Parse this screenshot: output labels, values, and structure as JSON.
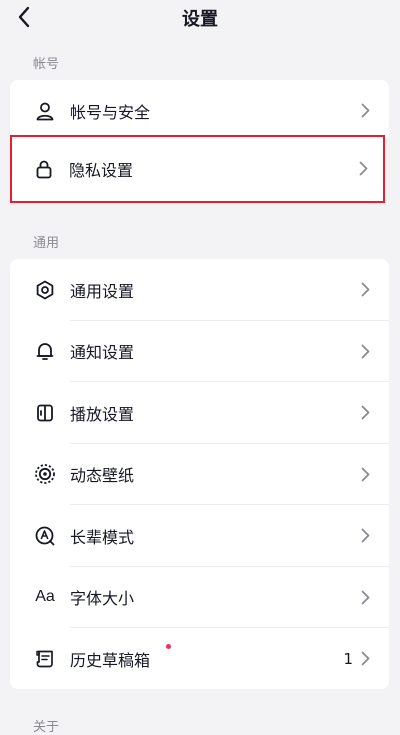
{
  "header": {
    "title": "设置"
  },
  "sections": {
    "account": {
      "label": "帐号",
      "items": [
        {
          "label": "帐号与安全",
          "icon": "user-icon"
        },
        {
          "label": "隐私设置",
          "icon": "lock-icon"
        }
      ]
    },
    "general": {
      "label": "通用",
      "items": [
        {
          "label": "通用设置",
          "icon": "gear-icon"
        },
        {
          "label": "通知设置",
          "icon": "bell-icon"
        },
        {
          "label": "播放设置",
          "icon": "playback-icon"
        },
        {
          "label": "动态壁纸",
          "icon": "wallpaper-icon"
        },
        {
          "label": "长辈模式",
          "icon": "elder-mode-icon"
        },
        {
          "label": "字体大小",
          "icon": "font-size-icon",
          "icon_text": "Aa"
        },
        {
          "label": "历史草稿箱",
          "icon": "drafts-icon",
          "count": "1",
          "has_badge": true
        }
      ]
    },
    "about": {
      "label": "关于"
    }
  },
  "colors": {
    "background": "#f3f3f5",
    "highlight": "#e2202f",
    "badge": "#fe2c55"
  }
}
